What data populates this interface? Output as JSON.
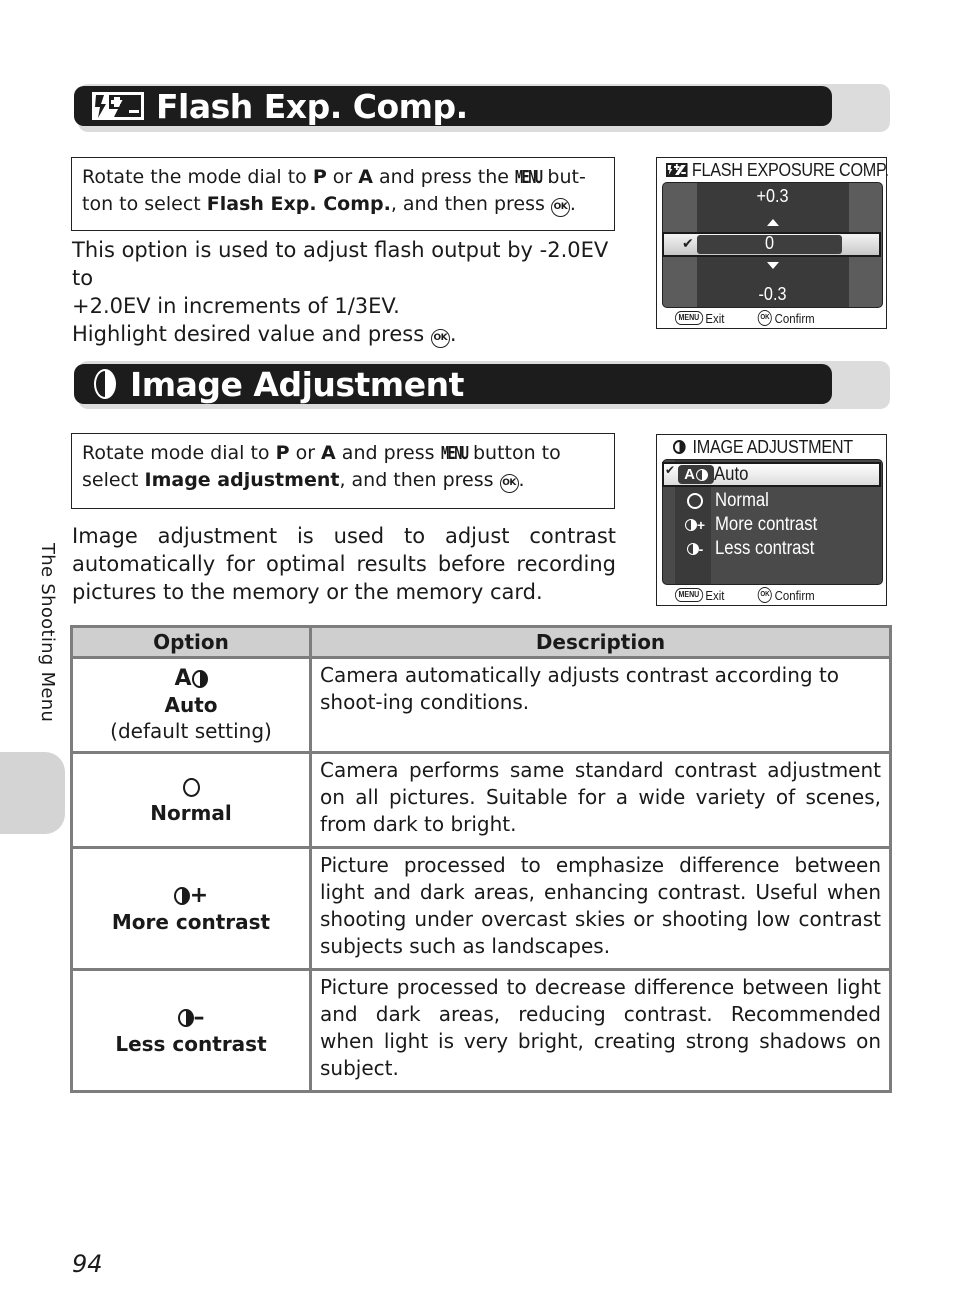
{
  "page": {
    "number": "94",
    "side_tab_label": "The Shooting Menu"
  },
  "flash_section": {
    "icon": "flash-exposure-comp-icon",
    "title": "Flash Exp. Comp.",
    "instruction": {
      "part1": "Rotate the mode dial to ",
      "mode_p": "P",
      "or": " or ",
      "mode_a": "A",
      "part2": " and press the ",
      "menu_glyph": "MENU",
      "part3": " but-ton to select ",
      "item": "Flash Exp. Comp.",
      "part4": ", and then press ",
      "ok_glyph": "OK",
      "end": "."
    },
    "body_lines": [
      "This option is used to adjust flash output by -2.0EV to",
      "+2.0EV in increments of 1/3EV.",
      "Highlight desired value and press"
    ],
    "body_ok_glyph": "OK",
    "body_end": ".",
    "screen": {
      "title": "FLASH EXPOSURE COMP.",
      "value_above": "+0.3",
      "value_selected": "0",
      "value_below": "-0.3",
      "footer_menu": "MENU",
      "footer_exit": "Exit",
      "footer_ok": "OK",
      "footer_confirm": "Confirm"
    }
  },
  "image_section": {
    "icon": "contrast-icon",
    "title": "Image Adjustment",
    "instruction": {
      "part1": "Rotate mode dial to ",
      "mode_p": "P",
      "or": " or ",
      "mode_a": "A",
      "part2": " and press ",
      "menu_glyph": "MENU",
      "part3": " button to select ",
      "item": "Image adjustment",
      "part4": ", and then press ",
      "ok_glyph": "OK",
      "end": "."
    },
    "body": "Image adjustment is used to adjust contrast automatically for optimal results before recording pictures to the memory or the memory card.",
    "screen": {
      "title": "IMAGE ADJUSTMENT",
      "items": [
        {
          "icon": "auto-contrast-icon",
          "icon_text": "A",
          "label": "Auto",
          "selected": true
        },
        {
          "icon": "normal-contrast-icon",
          "icon_text": "",
          "label": "Normal",
          "selected": false
        },
        {
          "icon": "more-contrast-icon",
          "icon_text": "+",
          "label": "More contrast",
          "selected": false
        },
        {
          "icon": "less-contrast-icon",
          "icon_text": "-",
          "label": "Less contrast",
          "selected": false
        }
      ],
      "footer_menu": "MENU",
      "footer_exit": "Exit",
      "footer_ok": "OK",
      "footer_confirm": "Confirm"
    },
    "table": {
      "headers": [
        "Option",
        "Description"
      ],
      "rows": [
        {
          "icon": "auto-contrast-icon",
          "icon_text": "A",
          "name": "Auto",
          "note": "(default setting)",
          "description": "Camera automatically adjusts contrast according to shoot-ing conditions."
        },
        {
          "icon": "normal-contrast-icon",
          "icon_text": "",
          "name": "Normal",
          "note": "",
          "description": "Camera performs same standard contrast adjustment on all pictures. Suitable for a wide variety of scenes, from dark to bright."
        },
        {
          "icon": "more-contrast-icon",
          "icon_text": "+",
          "name": "More contrast",
          "note": "",
          "description": "Picture processed to emphasize difference between light and dark areas, enhancing contrast. Useful when shooting under overcast skies or shooting low contrast subjects such as landscapes."
        },
        {
          "icon": "less-contrast-icon",
          "icon_text": "–",
          "name": "Less contrast",
          "note": "",
          "description": "Picture processed to decrease difference between light and dark areas, reducing contrast. Recommended when light is very bright, creating strong shadows on subject."
        }
      ]
    }
  }
}
